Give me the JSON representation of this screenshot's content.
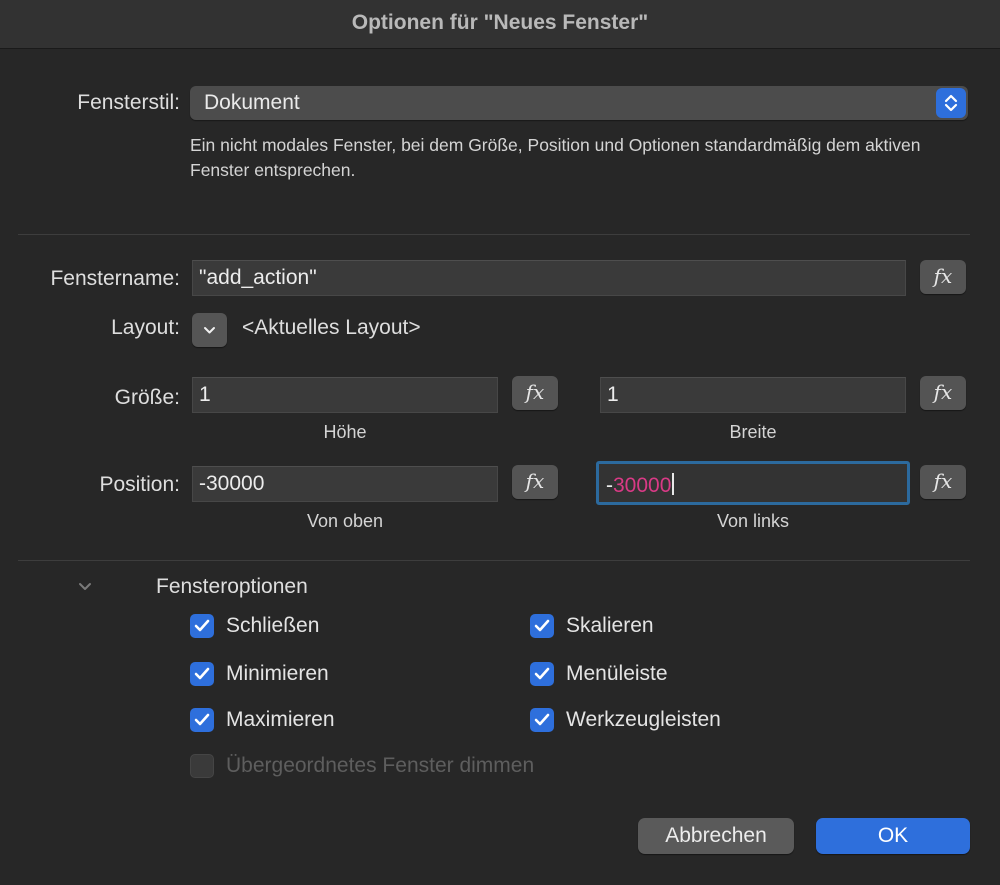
{
  "window": {
    "title": "Optionen für \"Neues Fenster\""
  },
  "style": {
    "label": "Fensterstil:",
    "value": "Dokument",
    "description": "Ein nicht modales Fenster, bei dem Größe, Position und Optionen standardmäßig dem aktiven Fenster entsprechen."
  },
  "name": {
    "label": "Fenstername:",
    "value": "\"add_action\"",
    "fx": "fx"
  },
  "layout": {
    "label": "Layout:",
    "value": "<Aktuelles Layout>"
  },
  "size": {
    "label": "Größe:",
    "height_value": "1",
    "height_label": "Höhe",
    "width_value": "1",
    "width_label": "Breite",
    "fx": "fx"
  },
  "position": {
    "label": "Position:",
    "top_value": "-30000",
    "top_label": "Von oben",
    "left_prefix": "-",
    "left_selected": "30000",
    "left_label": "Von links",
    "fx": "fx"
  },
  "options": {
    "header": "Fensteroptionen",
    "items": [
      {
        "label": "Schließen",
        "checked": true,
        "enabled": true
      },
      {
        "label": "Skalieren",
        "checked": true,
        "enabled": true
      },
      {
        "label": "Minimieren",
        "checked": true,
        "enabled": true
      },
      {
        "label": "Menüleiste",
        "checked": true,
        "enabled": true
      },
      {
        "label": "Maximieren",
        "checked": true,
        "enabled": true
      },
      {
        "label": "Werkzeugleisten",
        "checked": true,
        "enabled": true
      },
      {
        "label": "Übergeordnetes Fenster dimmen",
        "checked": false,
        "enabled": false
      }
    ]
  },
  "buttons": {
    "cancel": "Abbrechen",
    "ok": "OK"
  },
  "colors": {
    "accent": "#2e6fdc",
    "selection_text": "#d93a86",
    "focus_ring": "#2c6a9e"
  },
  "icons": {
    "popup": "up-down-chevron-icon",
    "layout": "chevron-down-icon",
    "disclosure": "chevron-down-icon",
    "checkbox": "checkmark-icon"
  }
}
